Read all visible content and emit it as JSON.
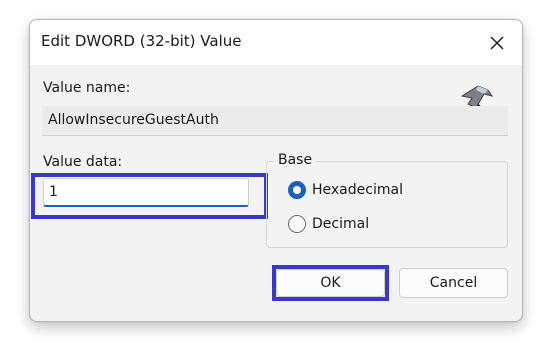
{
  "dialog": {
    "title": "Edit DWORD (32-bit) Value",
    "close_icon": "close-icon"
  },
  "value_name": {
    "label": "Value name:",
    "value": "AllowInsecureGuestAuth"
  },
  "value_data": {
    "label": "Value data:",
    "value": "1"
  },
  "base": {
    "legend": "Base",
    "options": [
      {
        "label": "Hexadecimal",
        "checked": true
      },
      {
        "label": "Decimal",
        "checked": false
      }
    ]
  },
  "buttons": {
    "ok": "OK",
    "cancel": "Cancel"
  },
  "colors": {
    "highlight": "#3939c4",
    "accent": "#1f5fb8"
  },
  "icons": {
    "registry_icon": "hammer-icon"
  }
}
